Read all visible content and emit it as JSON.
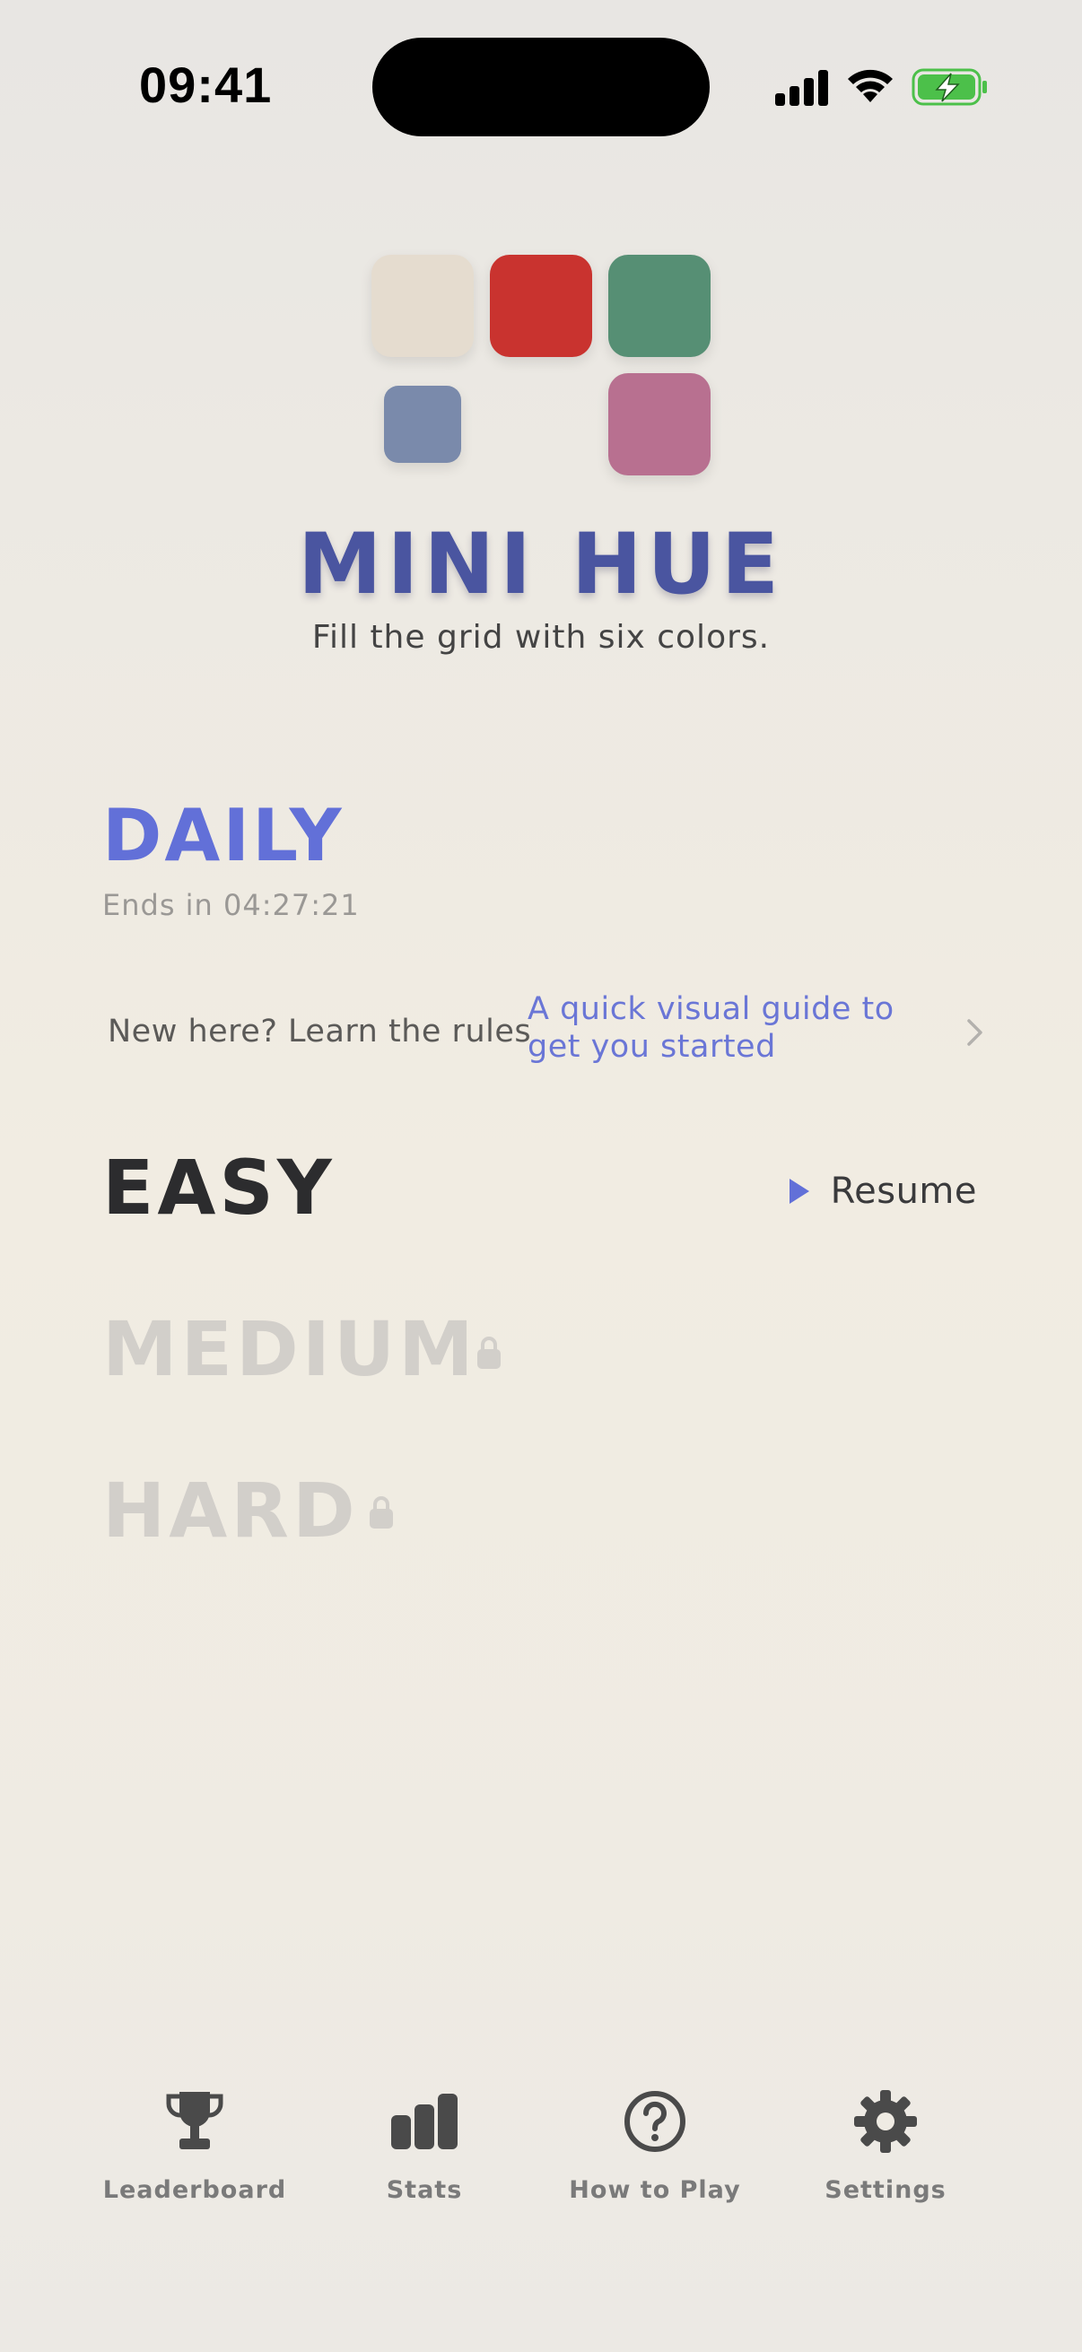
{
  "status_bar": {
    "time": "09:41"
  },
  "header": {
    "title": "MINI HUE",
    "subtitle": "Fill the grid with six colors.",
    "tile_colors": [
      "#e5dccf",
      "#c9332f",
      "#568f74",
      "#7a8aab",
      "#b87090"
    ]
  },
  "daily": {
    "title": "DAILY",
    "ends_text": "Ends in 04:27:21"
  },
  "rules": {
    "prompt": "New here? Learn the rules",
    "link": "A quick visual guide to get you started"
  },
  "levels": {
    "easy": "EASY",
    "medium": "MEDIUM",
    "hard": "HARD",
    "resume_label": "Resume",
    "locked": [
      "MEDIUM",
      "HARD"
    ]
  },
  "nav": {
    "leaderboard": "Leaderboard",
    "stats": "Stats",
    "how_to_play": "How to Play",
    "settings": "Settings"
  },
  "colors": {
    "accent": "#6270d8",
    "title": "#4a55a0",
    "battery": "#4cc04a"
  }
}
